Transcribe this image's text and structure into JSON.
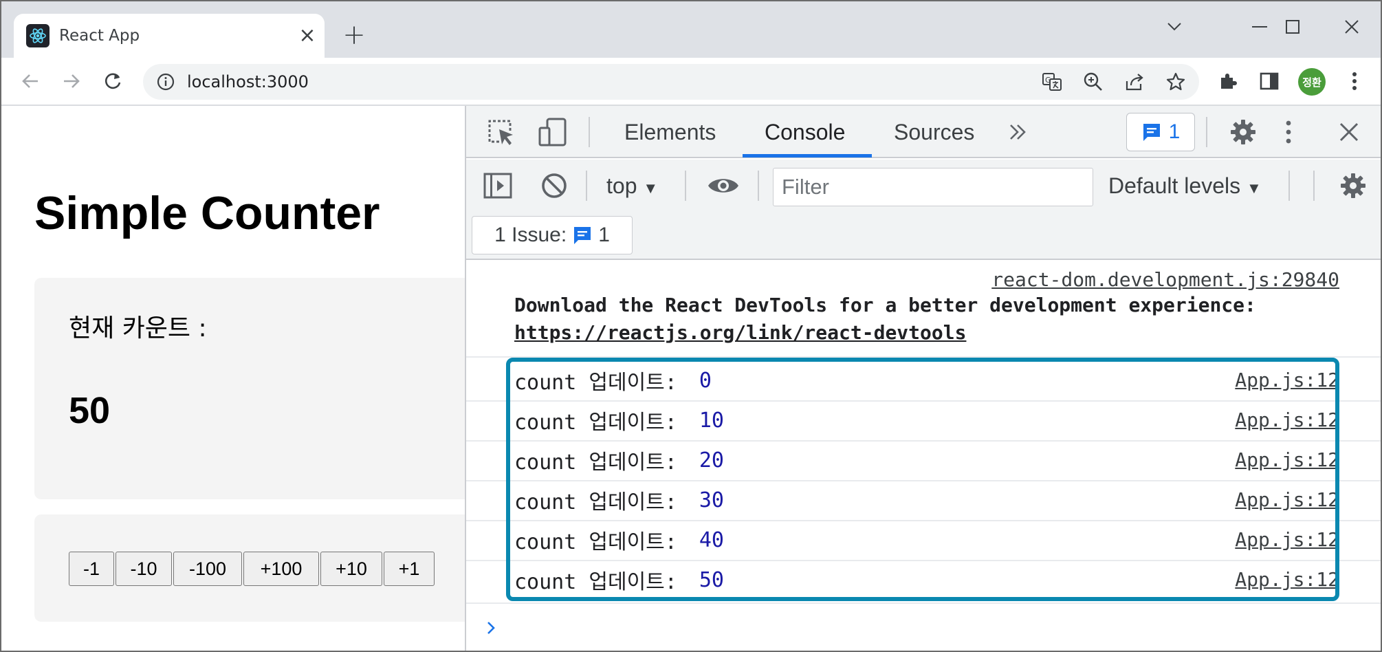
{
  "browser": {
    "tab_title": "React App",
    "url": "localhost:3000",
    "avatar_text": "정환"
  },
  "page": {
    "title": "Simple Counter",
    "count_label": "현재 카운트 :",
    "count_value": "50",
    "buttons": [
      "-1",
      "-10",
      "-100",
      "+100",
      "+10",
      "+1"
    ]
  },
  "devtools": {
    "tabs": [
      {
        "label": "Elements",
        "active": false
      },
      {
        "label": "Console",
        "active": true
      },
      {
        "label": "Sources",
        "active": false
      }
    ],
    "message_count": "1",
    "context": "top",
    "filter_placeholder": "Filter",
    "levels": "Default levels",
    "issues_label": "1 Issue:",
    "issues_count": "1",
    "accent_color": "#1a73e8",
    "highlight_color": "#0a88b0",
    "console": {
      "dev_source": "react-dom.development.js:29840",
      "dev_message": "Download the React DevTools for a better development experience:",
      "dev_link": "https://reactjs.org/link/react-devtools",
      "log_label": "count 업데이트:",
      "log_source": "App.js:12",
      "logs": [
        "0",
        "10",
        "20",
        "30",
        "40",
        "50"
      ]
    }
  }
}
